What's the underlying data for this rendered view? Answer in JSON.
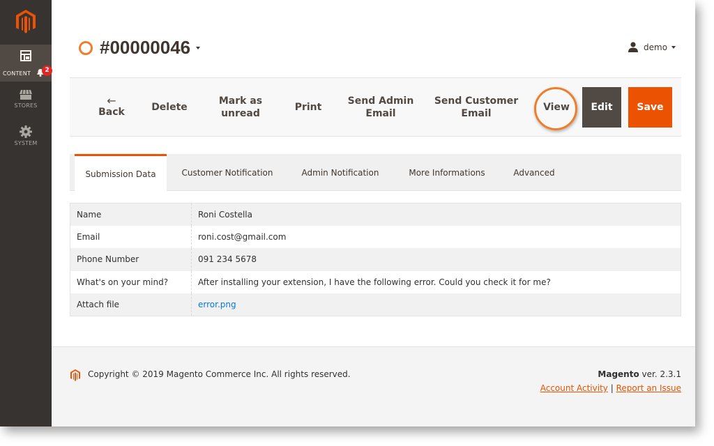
{
  "sidebar": {
    "items": [
      {
        "label": "CONTENT",
        "icon": "content-layout-icon",
        "active": true
      },
      {
        "label": "STORES",
        "icon": "store-awning-icon"
      },
      {
        "label": "SYSTEM",
        "icon": "gear-icon"
      }
    ],
    "notification_count": "2"
  },
  "header": {
    "title": "#00000046",
    "user": "demo"
  },
  "toolbar": {
    "back_arrow": "←",
    "back_label": "Back",
    "delete_label": "Delete",
    "mark_unread_line1": "Mark as",
    "mark_unread_line2": "unread",
    "print_label": "Print",
    "send_admin_line1": "Send Admin",
    "send_admin_line2": "Email",
    "send_customer_line1": "Send Customer",
    "send_customer_line2": "Email",
    "view_label": "View",
    "edit_label": "Edit",
    "save_label": "Save"
  },
  "tabs": [
    {
      "label": "Submission Data",
      "active": true
    },
    {
      "label": "Customer Notification"
    },
    {
      "label": "Admin Notification"
    },
    {
      "label": "More Informations"
    },
    {
      "label": "Advanced"
    }
  ],
  "submission": [
    {
      "field": "Name",
      "value": "Roni Costella"
    },
    {
      "field": "Email",
      "value": "roni.cost@gmail.com"
    },
    {
      "field": "Phone Number",
      "value": "091 234 5678"
    },
    {
      "field": "What's on your mind?",
      "value": "After installing your extension, I have the following error. Could you check it for me?"
    },
    {
      "field": "Attach file",
      "value": "error.png",
      "is_link": true
    }
  ],
  "footer": {
    "copyright": "Copyright © 2019 Magento Commerce Inc. All rights reserved.",
    "brand": "Magento",
    "version": " ver. 2.3.1",
    "account_activity": "Account Activity",
    "separator": "|",
    "report_issue": "Report an Issue"
  },
  "colors": {
    "accent": "#eb5202",
    "highlight_ring": "#f07d2a",
    "sidebar_bg": "#373330",
    "edit_bg": "#514943",
    "link": "#007bdb"
  }
}
